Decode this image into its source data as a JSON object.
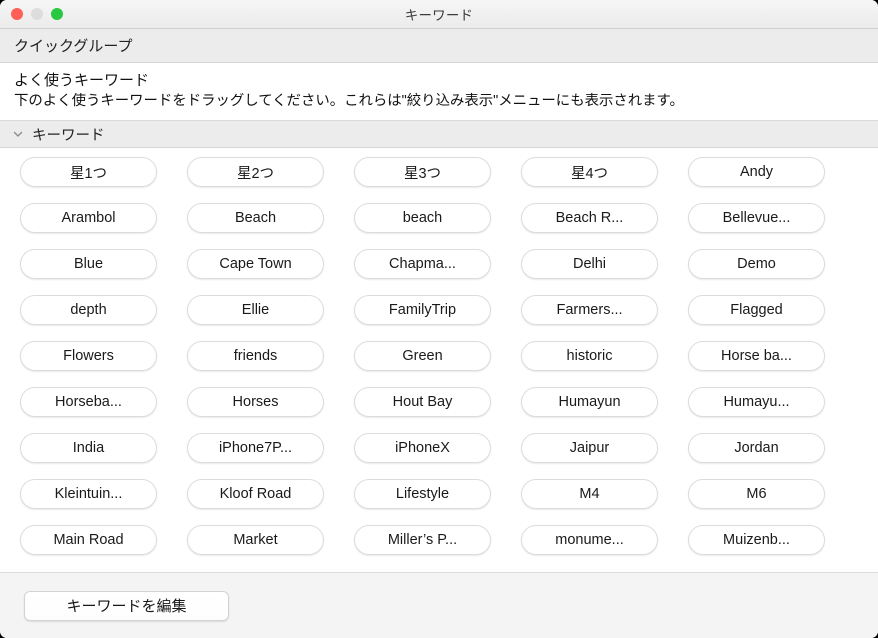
{
  "window": {
    "title": "キーワード",
    "traffic_lights": [
      {
        "name": "close",
        "color": "#ff5f57"
      },
      {
        "name": "minimize",
        "color": "#dddddd"
      },
      {
        "name": "zoom",
        "color": "#28c940"
      }
    ]
  },
  "quick_group": {
    "label": "クイックグループ"
  },
  "description": {
    "title": "よく使うキーワード",
    "body": "下のよく使うキーワードをドラッグしてください。これらは\"絞り込み表示\"メニューにも表示されます。"
  },
  "section": {
    "label": "キーワード",
    "disclosure_icon": "chevron-down-icon",
    "expanded": true
  },
  "keywords": [
    "星1つ",
    "星2つ",
    "星3つ",
    "星4つ",
    "Andy",
    "Arambol",
    "Beach",
    "beach",
    "Beach R...",
    "Bellevue...",
    "Blue",
    "Cape Town",
    "Chapma...",
    "Delhi",
    "Demo",
    "depth",
    "Ellie",
    "FamilyTrip",
    "Farmers...",
    "Flagged",
    "Flowers",
    "friends",
    "Green",
    "historic",
    "Horse ba...",
    "Horseba...",
    "Horses",
    "Hout Bay",
    "Humayun",
    "Humayu...",
    "India",
    "iPhone7P...",
    "iPhoneX",
    "Jaipur",
    "Jordan",
    "Kleintuin...",
    "Kloof Road",
    "Lifestyle",
    "M4",
    "M6",
    "Main Road",
    "Market",
    "Miller’s P...",
    "monume...",
    "Muizenb..."
  ],
  "footer": {
    "edit_button_label": "キーワードを編集"
  },
  "colors": {
    "window_bg": "#ffffff",
    "header_bg": "#ececec",
    "footer_bg": "#f4f4f4",
    "pill_border": "#dcdcdc",
    "text": "#1a1a1a"
  }
}
